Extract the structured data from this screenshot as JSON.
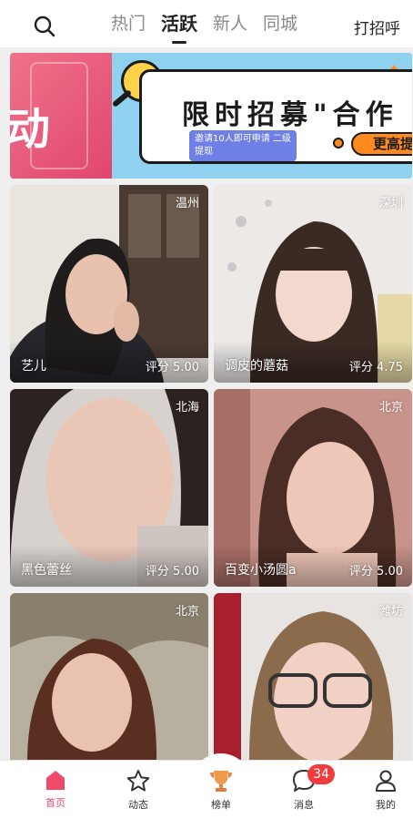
{
  "header": {
    "tabs": [
      {
        "label": "热门",
        "active": false
      },
      {
        "label": "活跃",
        "active": true
      },
      {
        "label": "新人",
        "active": false
      },
      {
        "label": "同城",
        "active": false
      }
    ],
    "greet_label": "打招呼"
  },
  "banner": {
    "left_text": "动",
    "title": "限时招募\"合作",
    "chip_text": "邀请10人即可申请 二级提现",
    "cta_text": "更高提"
  },
  "cards": [
    {
      "city": "温州",
      "name": "艺儿",
      "score": "评分 5.00",
      "photo_tone": "#3a3d47"
    },
    {
      "city": "深圳",
      "name": "调皮的蘑菇",
      "score": "评分 4.75",
      "photo_tone": "#d9d3cf"
    },
    {
      "city": "北海",
      "name": "黑色蕾丝",
      "score": "评分 5.00",
      "photo_tone": "#c9b7ad"
    },
    {
      "city": "北京",
      "name": "百变小汤圆a",
      "score": "评分 5.00",
      "photo_tone": "#c89b8e"
    },
    {
      "city": "北京",
      "name": "",
      "score": "",
      "photo_tone": "#8f8574"
    },
    {
      "city": "潍坊",
      "name": "",
      "score": "",
      "photo_tone": "#a08c86"
    }
  ],
  "bottom_nav": {
    "items": [
      {
        "label": "首页",
        "icon": "home-icon",
        "active": true
      },
      {
        "label": "动态",
        "icon": "star-icon",
        "active": false
      },
      {
        "label": "榜单",
        "icon": "trophy-icon",
        "active": false
      },
      {
        "label": "消息",
        "icon": "chat-icon",
        "active": false
      },
      {
        "label": "我的",
        "icon": "user-icon",
        "active": false
      }
    ],
    "message_badge": "34"
  },
  "colors": {
    "accent": "#ee4a6a",
    "badge": "#f03c3c"
  }
}
